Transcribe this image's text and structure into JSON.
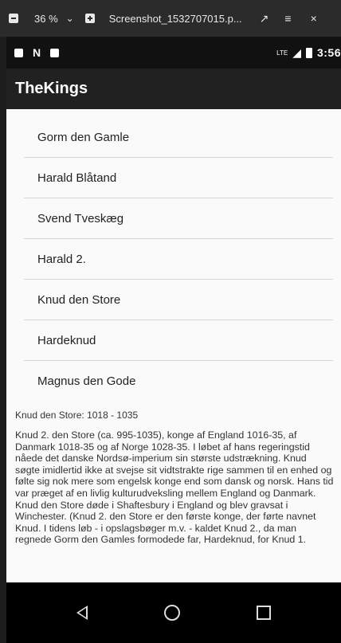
{
  "viewer": {
    "zoom": "36 %",
    "filename": "Screenshot_1532707015.p...",
    "chevron": "⌄",
    "expand": "↗",
    "menu": "≡",
    "close": "×"
  },
  "status": {
    "lte": "LTE",
    "time": "3:56"
  },
  "app": {
    "title": "TheKings"
  },
  "kings": [
    "Gorm den Gamle",
    "Harald Blåtand",
    "Svend Tveskæg",
    "Harald 2.",
    "Knud den Store",
    "Hardeknud",
    "Magnus den Gode"
  ],
  "detail": {
    "title": "Knud den Store: 1018 - 1035",
    "body": "Knud 2. den Store (ca. 995-1035), konge af England 1016-35, af Danmark 1018-35 og af Norge 1028-35. I løbet af hans regeringstid nåede det danske Nordsø-imperium sin største udstrækning. Knud søgte imidlertid ikke at svejse sit vidtstrakte rige sammen til en enhed og følte sig nok mere som engelsk konge end som dansk og norsk. Hans tid var præget af en livlig kulturudveksling mellem England og Danmark. Knud den Store døde i Shaftesbury i England og blev gravsat i Winchester. (Knud 2. den Store er den første konge, der førte navnet Knud. I tidens løb - i opslagsbøger m.v. - kaldet Knud 2., da man regnede Gorm den Gamles formodede far, Hardeknud, for Knud 1."
  }
}
